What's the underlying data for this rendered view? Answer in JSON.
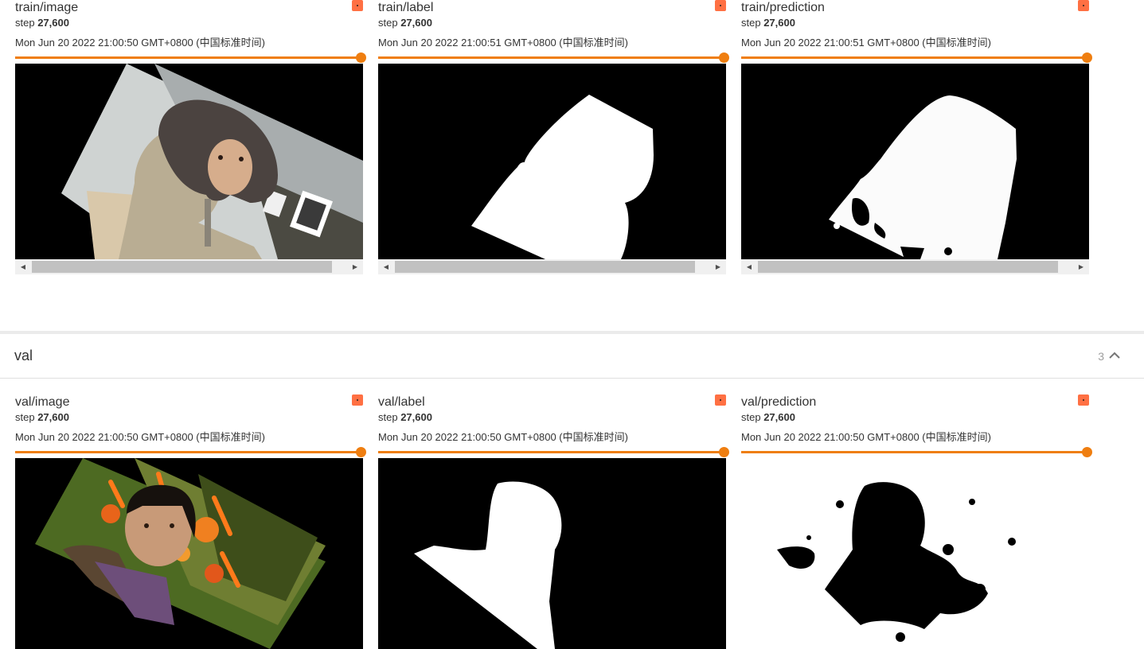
{
  "train": {
    "cards": [
      {
        "title": "train/image",
        "step_prefix": "step",
        "step": "27,600",
        "time": "Mon Jun 20 2022 21:00:50 GMT+0800 (中国标准时间)"
      },
      {
        "title": "train/label",
        "step_prefix": "step",
        "step": "27,600",
        "time": "Mon Jun 20 2022 21:00:51 GMT+0800 (中国标准时间)"
      },
      {
        "title": "train/prediction",
        "step_prefix": "step",
        "step": "27,600",
        "time": "Mon Jun 20 2022 21:00:51 GMT+0800 (中国标准时间)"
      }
    ]
  },
  "val": {
    "section_name": "val",
    "count": "3",
    "cards": [
      {
        "title": "val/image",
        "step_prefix": "step",
        "step": "27,600",
        "time": "Mon Jun 20 2022 21:00:50 GMT+0800 (中国标准时间)"
      },
      {
        "title": "val/label",
        "step_prefix": "step",
        "step": "27,600",
        "time": "Mon Jun 20 2022 21:00:50 GMT+0800 (中国标准时间)"
      },
      {
        "title": "val/prediction",
        "step_prefix": "step",
        "step": "27,600",
        "time": "Mon Jun 20 2022 21:00:50 GMT+0800 (中国标准时间)"
      }
    ]
  },
  "colors": {
    "accent": "#ef7e10",
    "badge": "#ff7043"
  },
  "icons": {
    "badge": "color-badge-icon",
    "collapse": "chevron-up-icon",
    "scroll_left": "scroll-left-arrow-icon",
    "scroll_right": "scroll-right-arrow-icon"
  }
}
